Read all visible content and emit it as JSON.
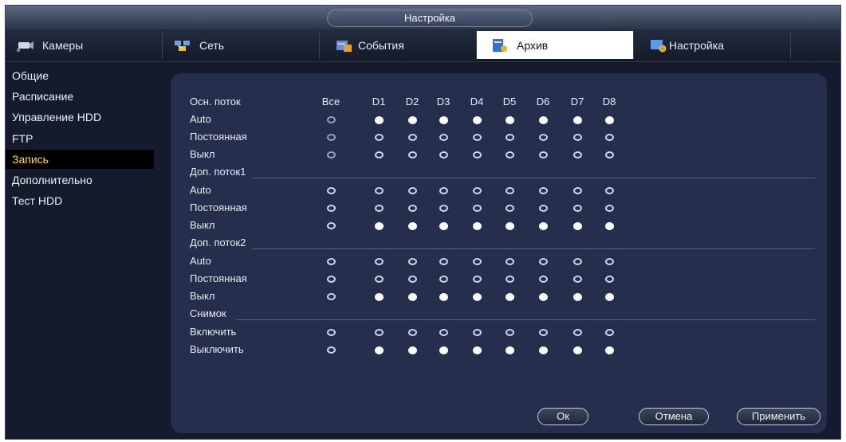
{
  "title": "Настройка",
  "tabs": [
    {
      "label": "Камеры",
      "icon": "camera-icon"
    },
    {
      "label": "Сеть",
      "icon": "network-icon"
    },
    {
      "label": "События",
      "icon": "events-icon"
    },
    {
      "label": "Архив",
      "icon": "archive-icon"
    },
    {
      "label": "Настройка",
      "icon": "settings-icon"
    }
  ],
  "sidebar": {
    "items": [
      {
        "label": "Общие"
      },
      {
        "label": "Расписание"
      },
      {
        "label": "Управление HDD"
      },
      {
        "label": "FTP"
      },
      {
        "label": "Запись",
        "active": true
      },
      {
        "label": "Дополнительно"
      },
      {
        "label": "Тест HDD"
      }
    ]
  },
  "table": {
    "header_label": "Осн. поток",
    "columns": [
      "Все",
      "D1",
      "D2",
      "D3",
      "D4",
      "D5",
      "D6",
      "D7",
      "D8"
    ],
    "sections": [
      {
        "title": "",
        "rows": [
          {
            "label": "Auto",
            "selected": [
              false,
              true,
              true,
              true,
              true,
              true,
              true,
              true,
              true
            ]
          },
          {
            "label": "Постоянная",
            "selected": [
              false,
              false,
              false,
              false,
              false,
              false,
              false,
              false,
              false
            ]
          },
          {
            "label": "Выкл",
            "selected": [
              false,
              false,
              false,
              false,
              false,
              false,
              false,
              false,
              false
            ]
          }
        ]
      },
      {
        "title": "Доп. поток1",
        "rows": [
          {
            "label": "Auto",
            "selected": [
              false,
              false,
              false,
              false,
              false,
              false,
              false,
              false,
              false
            ]
          },
          {
            "label": "Постоянная",
            "selected": [
              false,
              false,
              false,
              false,
              false,
              false,
              false,
              false,
              false
            ]
          },
          {
            "label": "Выкл",
            "selected": [
              false,
              true,
              true,
              true,
              true,
              true,
              true,
              true,
              true
            ]
          }
        ]
      },
      {
        "title": "Доп. поток2",
        "rows": [
          {
            "label": "Auto",
            "selected": [
              false,
              false,
              false,
              false,
              false,
              false,
              false,
              false,
              false
            ]
          },
          {
            "label": "Постоянная",
            "selected": [
              false,
              false,
              false,
              false,
              false,
              false,
              false,
              false,
              false
            ]
          },
          {
            "label": "Выкл",
            "selected": [
              false,
              true,
              true,
              true,
              true,
              true,
              true,
              true,
              true
            ]
          }
        ]
      },
      {
        "title": "Снимок",
        "rows": [
          {
            "label": "Включить",
            "selected": [
              false,
              false,
              false,
              false,
              false,
              false,
              false,
              false,
              false
            ]
          },
          {
            "label": "Выключить",
            "selected": [
              false,
              true,
              true,
              true,
              true,
              true,
              true,
              true,
              true
            ]
          }
        ]
      }
    ]
  },
  "buttons": {
    "ok": "Ок",
    "cancel": "Отмена",
    "apply": "Применить"
  },
  "colors": {
    "active_sidebar_text": "#ffd84a",
    "panel_background": "#252f4d"
  }
}
